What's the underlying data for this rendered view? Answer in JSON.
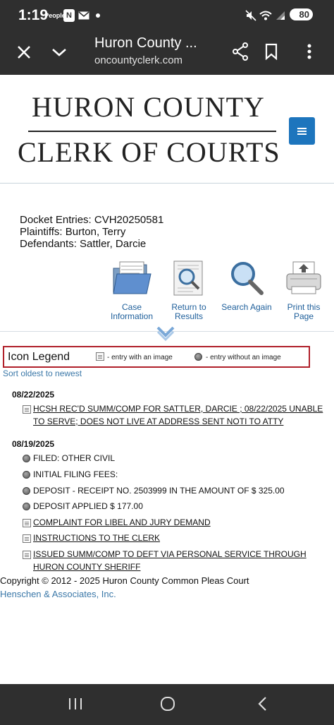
{
  "status_bar": {
    "time": "1:19",
    "app_icons": [
      "People",
      "N",
      "mail-icon"
    ],
    "battery": "80",
    "system_icons": [
      "mute-icon",
      "wifi-icon",
      "signal-icon"
    ]
  },
  "browser": {
    "title": "Huron County ...",
    "url": "oncountyclerk.com",
    "buttons": [
      "close-icon",
      "chevron-down-icon",
      "share-icon",
      "bookmark-icon",
      "more-vert-icon"
    ]
  },
  "header": {
    "logo_line1": "HURON COUNTY",
    "logo_line2": "CLERK OF COURTS",
    "menu_icon": "hamburger-icon",
    "accent_color": "#1d75bd"
  },
  "docket": {
    "entries_line": "Docket Entries: CVH20250581",
    "plaintiffs_line": "Plaintiffs: Burton, Terry",
    "defendants_line": "Defendants: Sattler, Darcie"
  },
  "tools": [
    {
      "label_1": "Case",
      "label_2": "Information",
      "icon": "folder-icon"
    },
    {
      "label_1": "Return to",
      "label_2": "Results",
      "icon": "document-magnifier-icon"
    },
    {
      "label_1": "Search Again",
      "label_2": "",
      "icon": "magnifier-icon"
    },
    {
      "label_1": "Print this",
      "label_2": "Page",
      "icon": "printer-icon"
    }
  ],
  "legend": {
    "title": "Icon Legend",
    "with_image": "- entry with an image",
    "without_image": "- entry without an image",
    "border_color": "#b0202a"
  },
  "sort_link": "Sort oldest to newest",
  "groups": [
    {
      "date": "08/22/2025",
      "entries": [
        {
          "text": "HCSH REC'D SUMM/COMP FOR SATTLER, DARCIE ; 08/22/2025 UNABLE TO SERVE; DOES NOT LIVE AT ADDRESS SENT NOTI TO ATTY",
          "has_image": true
        }
      ]
    },
    {
      "date": "08/19/2025",
      "entries": [
        {
          "text": "FILED: OTHER CIVIL",
          "has_image": false
        },
        {
          "text": "INITIAL FILING FEES:",
          "has_image": false
        },
        {
          "text": "DEPOSIT - RECEIPT NO. 2503999 IN THE AMOUNT OF $ 325.00",
          "has_image": false
        },
        {
          "text": "DEPOSIT APPLIED $ 177.00",
          "has_image": false
        },
        {
          "text": "COMPLAINT FOR LIBEL AND JURY DEMAND",
          "has_image": true
        },
        {
          "text": "INSTRUCTIONS TO THE CLERK",
          "has_image": true
        },
        {
          "text": "ISSUED SUMM/COMP TO DEFT VIA PERSONAL SERVICE THROUGH HURON COUNTY SHERIFF",
          "has_image": true
        }
      ]
    }
  ],
  "footer": {
    "copyright": "Copyright © 2012 - 2025 Huron County Common Pleas Court",
    "vendor": "Henschen & Associates, Inc."
  },
  "nav_bar": [
    "recents-icon",
    "home-icon",
    "back-icon"
  ]
}
